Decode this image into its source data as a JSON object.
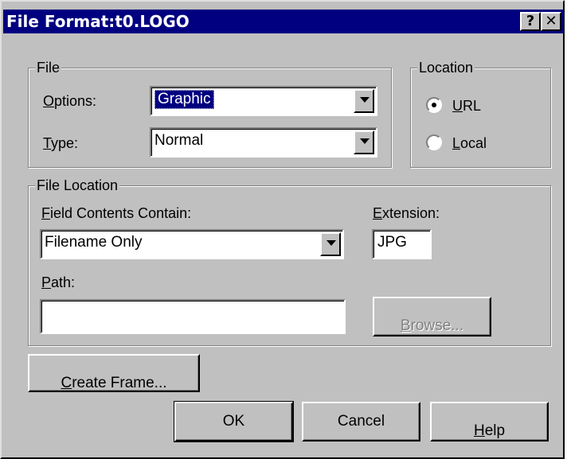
{
  "window": {
    "title": "File Format:t0.LOGO",
    "help_button": "?",
    "close_button": "✕"
  },
  "file_group": {
    "legend": "File",
    "options_label": "Options:",
    "options_value": "Graphic",
    "type_label": "Type:",
    "type_value": "Normal"
  },
  "location_group": {
    "legend": "Location",
    "url_label": "URL",
    "local_label": "Local",
    "selected": "URL"
  },
  "file_location_group": {
    "legend": "File Location",
    "field_contents_label": "Field Contents Contain:",
    "field_contents_value": "Filename Only",
    "extension_label": "Extension:",
    "extension_value": "JPG",
    "path_label": "Path:",
    "path_value": "",
    "browse_label": "Browse..."
  },
  "buttons": {
    "create_frame": "Create Frame...",
    "ok": "OK",
    "cancel": "Cancel",
    "help": "Help"
  }
}
